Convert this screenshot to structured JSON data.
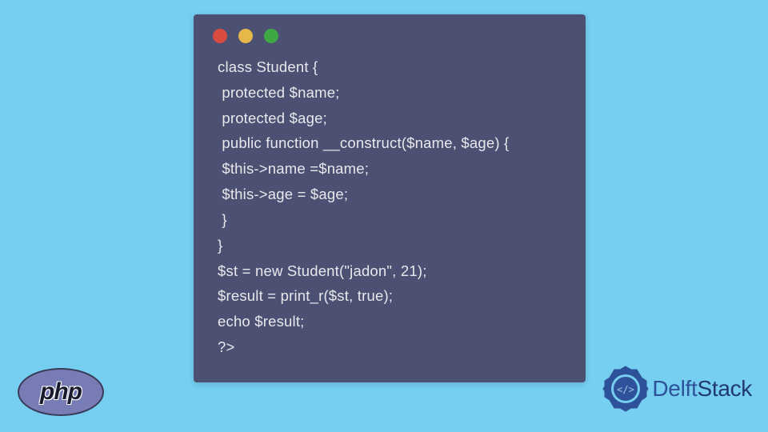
{
  "code": {
    "lines": [
      "class Student {",
      " protected $name;",
      " protected $age;",
      " public function __construct($name, $age) {",
      " $this->name =$name;",
      " $this->age = $age;",
      " }",
      "}",
      "$st = new Student(\"jadon\", 21);",
      "$result = print_r($st, true);",
      "echo $result;",
      "?>"
    ]
  },
  "logos": {
    "php": "php",
    "delftstack": {
      "delft": "Delft",
      "stack": "Stack"
    }
  }
}
